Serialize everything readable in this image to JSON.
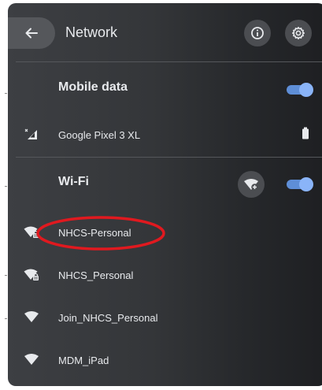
{
  "header": {
    "title": "Network",
    "back_icon": "arrow-left-icon",
    "info_icon": "info-icon",
    "settings_icon": "gear-icon"
  },
  "mobile": {
    "title": "Mobile data",
    "toggle_on": true,
    "device": {
      "label": "Google Pixel 3 XL",
      "signal_icon": "cellular-no-data-icon",
      "battery_icon": "battery-icon"
    }
  },
  "wifi": {
    "title": "Wi-Fi",
    "add_network_icon": "wifi-add-icon",
    "toggle_on": true,
    "networks": [
      {
        "label": "NHCS-Personal",
        "icon": "wifi-lock-icon",
        "highlighted": true
      },
      {
        "label": "NHCS_Personal",
        "icon": "wifi-lock-icon",
        "highlighted": false
      },
      {
        "label": "Join_NHCS_Personal",
        "icon": "wifi-icon",
        "highlighted": false
      },
      {
        "label": "MDM_iPad",
        "icon": "wifi-icon",
        "highlighted": false
      }
    ]
  },
  "colors": {
    "accent": "#8ab4f8",
    "toggle_track": "#5e8ed7",
    "highlight": "#e0191f",
    "panel": "#343639"
  }
}
